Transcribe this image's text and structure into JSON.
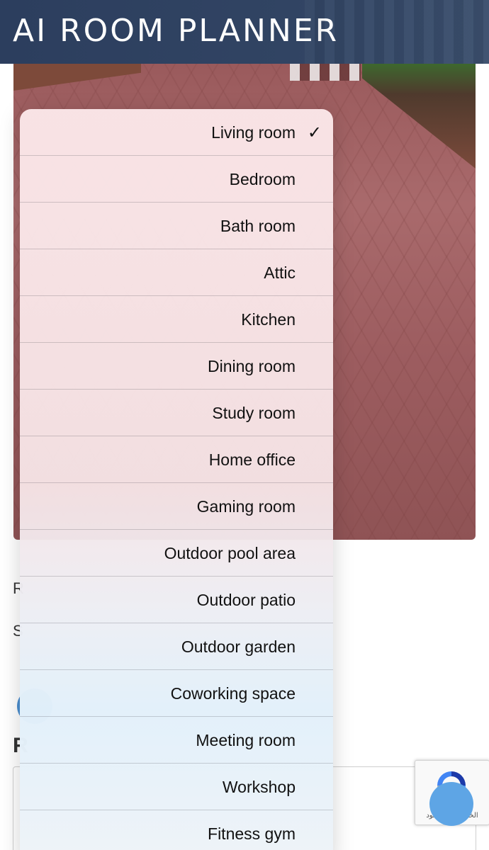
{
  "header": {
    "title": "AI ROOM PLANNER"
  },
  "form": {
    "label_r": "R",
    "label_s": "S",
    "section_heading": "R"
  },
  "room_menu": {
    "selected": "Living room",
    "items": [
      {
        "label": "Living room",
        "checked": true
      },
      {
        "label": "Bedroom",
        "checked": false
      },
      {
        "label": "Bath room",
        "checked": false
      },
      {
        "label": "Attic",
        "checked": false
      },
      {
        "label": "Kitchen",
        "checked": false
      },
      {
        "label": "Dining room",
        "checked": false
      },
      {
        "label": "Study room",
        "checked": false
      },
      {
        "label": "Home office",
        "checked": false
      },
      {
        "label": "Gaming room",
        "checked": false
      },
      {
        "label": "Outdoor pool area",
        "checked": false
      },
      {
        "label": "Outdoor patio",
        "checked": false
      },
      {
        "label": "Outdoor garden",
        "checked": false
      },
      {
        "label": "Coworking space",
        "checked": false
      },
      {
        "label": "Meeting room",
        "checked": false
      },
      {
        "label": "Workshop",
        "checked": false
      },
      {
        "label": "Fitness gym",
        "checked": false
      }
    ],
    "check_glyph": "✓"
  },
  "recaptcha": {
    "text": "الخصوصية - البنود"
  },
  "colors": {
    "header_bg": "#2c3e5e",
    "accent_blue": "#5ea5e5"
  }
}
